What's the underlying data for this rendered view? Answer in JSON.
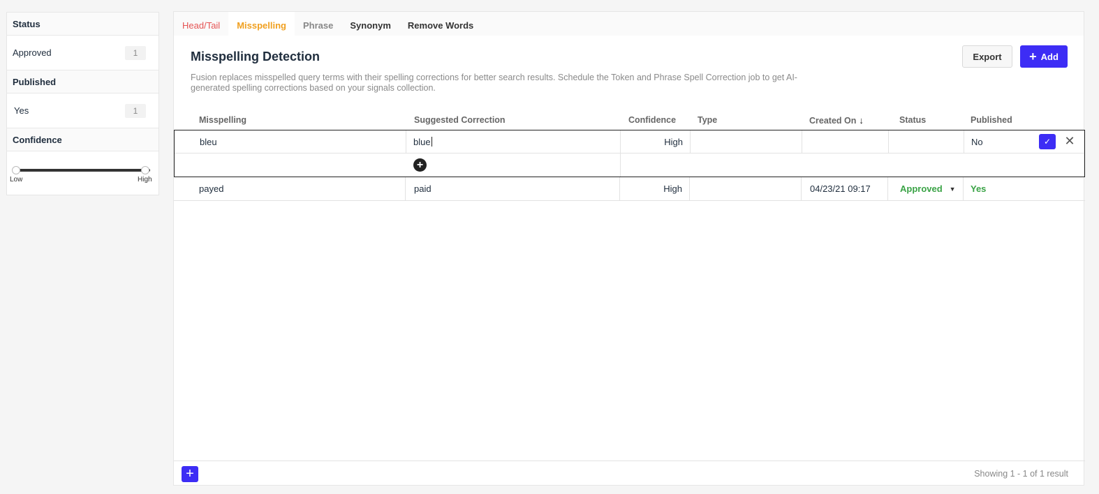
{
  "sidebar": {
    "status_header": "Status",
    "status_item_label": "Approved",
    "status_item_count": "1",
    "published_header": "Published",
    "published_item_label": "Yes",
    "published_item_count": "1",
    "confidence_header": "Confidence",
    "slider_low": "Low",
    "slider_high": "High"
  },
  "tabs": [
    "Head/Tail",
    "Misspelling",
    "Phrase",
    "Synonym",
    "Remove Words"
  ],
  "page": {
    "title": "Misspelling Detection",
    "description": "Fusion replaces misspelled query terms with their spelling corrections for better search results. Schedule the Token and Phrase Spell Correction job to get AI-generated spelling corrections based on your signals collection.",
    "export_label": "Export",
    "add_label": "Add"
  },
  "table": {
    "headers": {
      "misspelling": "Misspelling",
      "suggested": "Suggested Correction",
      "confidence": "Confidence",
      "type": "Type",
      "created": "Created On",
      "status": "Status",
      "published": "Published"
    },
    "edit_row": {
      "misspelling": "bleu",
      "suggested": "blue",
      "confidence": "High",
      "type": "",
      "created": "",
      "status": "",
      "published": "No"
    },
    "rows": [
      {
        "misspelling": "payed",
        "suggested": "paid",
        "confidence": "High",
        "type": "",
        "created": "04/23/21 09:17",
        "status": "Approved",
        "published": "Yes"
      }
    ]
  },
  "footer": {
    "info": "Showing 1 - 1 of 1 result"
  },
  "colors": {
    "accent": "#3d2df5",
    "active_tab": "#f0a020",
    "headtail_tab": "#e55353",
    "status_green": "#3aa346"
  }
}
